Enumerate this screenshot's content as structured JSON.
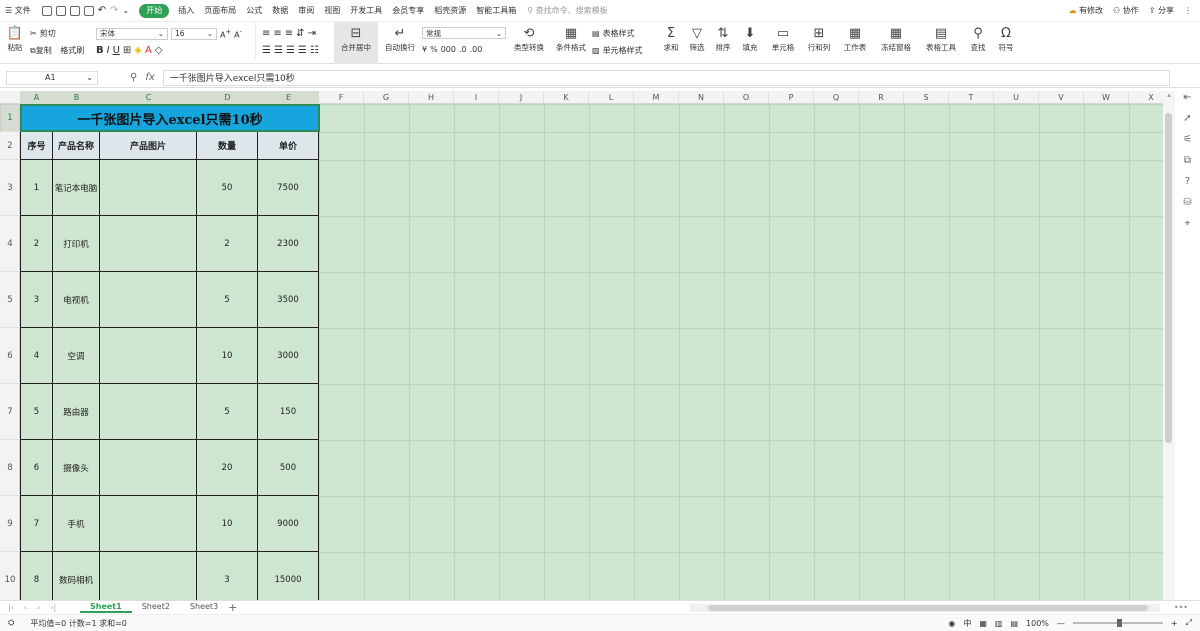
{
  "menu": {
    "file": "文件",
    "tabs": [
      "开始",
      "插入",
      "页面布局",
      "公式",
      "数据",
      "审阅",
      "视图",
      "开发工具",
      "会员专享",
      "稻壳资源",
      "智能工具箱"
    ],
    "search_placeholder": "查找命令、搜索模板",
    "has_changes": "有修改",
    "collaborate": "协作",
    "share": "分享"
  },
  "ribbon": {
    "paste": "粘贴",
    "cut": "剪切",
    "copy": "复制",
    "format_painter": "格式刷",
    "font_name": "宋体",
    "font_size": "16",
    "merge_center": "合并居中",
    "wrap_text": "自动换行",
    "number_format": "常规",
    "type_convert": "类型转换",
    "conditional_format": "条件格式",
    "table_style": "表格样式",
    "cell_style": "单元格样式",
    "sum": "求和",
    "filter": "筛选",
    "sort": "排序",
    "fill": "填充",
    "cell": "单元格",
    "row_col": "行和列",
    "worksheet": "工作表",
    "freeze": "冻结窗格",
    "table_tools": "表格工具",
    "find": "查找",
    "symbol": "符号"
  },
  "formula": {
    "cell_ref": "A1",
    "content": "一千张图片导入excel只需10秒"
  },
  "columns": [
    "A",
    "B",
    "C",
    "D",
    "E",
    "F",
    "G",
    "H",
    "I",
    "J",
    "K",
    "L",
    "M",
    "N",
    "O",
    "P",
    "Q",
    "R",
    "S",
    "T",
    "U",
    "V",
    "W",
    "X"
  ],
  "rows": [
    "1",
    "2",
    "3",
    "4",
    "5",
    "6",
    "7",
    "8",
    "9",
    "10"
  ],
  "table": {
    "title": "一千张图片导入excel只需10秒",
    "headers": [
      "序号",
      "产品名称",
      "产品图片",
      "数量",
      "单价"
    ],
    "data": [
      [
        "1",
        "笔记本电脑",
        "",
        "50",
        "7500"
      ],
      [
        "2",
        "打印机",
        "",
        "2",
        "2300"
      ],
      [
        "3",
        "电视机",
        "",
        "5",
        "3500"
      ],
      [
        "4",
        "空调",
        "",
        "10",
        "3000"
      ],
      [
        "5",
        "路由器",
        "",
        "5",
        "150"
      ],
      [
        "6",
        "摄像头",
        "",
        "20",
        "500"
      ],
      [
        "7",
        "手机",
        "",
        "10",
        "9000"
      ],
      [
        "8",
        "数码相机",
        "",
        "3",
        "15000"
      ]
    ]
  },
  "sheets": [
    "Sheet1",
    "Sheet2",
    "Sheet3"
  ],
  "status": {
    "stats": "平均值=0  计数=1  求和=0",
    "zoom": "100%"
  },
  "colors": {
    "accent": "#2ea158",
    "title_bg": "#17a5de",
    "header_bg": "#dde6ea",
    "grid_bg": "#cee6d0"
  }
}
